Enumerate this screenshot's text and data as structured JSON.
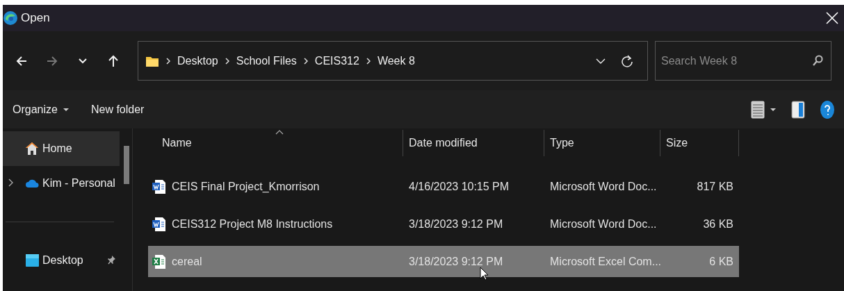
{
  "window": {
    "title": "Open"
  },
  "navigation": {
    "buttons": [
      {
        "kind": "back",
        "disabled": false
      },
      {
        "kind": "forward",
        "disabled": true
      },
      {
        "kind": "recent",
        "disabled": false
      },
      {
        "kind": "up",
        "disabled": false
      }
    ],
    "breadcrumb": [
      "Desktop",
      "School Files",
      "CEIS312",
      "Week 8"
    ],
    "search": {
      "placeholder": "Search Week 8"
    }
  },
  "toolbar": {
    "organize": "Organize",
    "new_folder": "New folder"
  },
  "sidebar": {
    "items": [
      {
        "label": "Home",
        "kind": "home",
        "selected": true,
        "expandable": false,
        "pinned": false
      },
      {
        "label": "Kim - Personal",
        "kind": "cloud",
        "selected": false,
        "expandable": true,
        "pinned": false
      },
      {
        "label": "Desktop",
        "kind": "desktop",
        "selected": false,
        "expandable": false,
        "pinned": true
      }
    ]
  },
  "table": {
    "columns": [
      "Name",
      "Date modified",
      "Type",
      "Size"
    ],
    "rows": [
      {
        "kind": "word",
        "name": "CEIS Final Project_Kmorrison",
        "date": "4/16/2023 10:15 PM",
        "type": "Microsoft Word Doc...",
        "size": "817 KB",
        "selected": false
      },
      {
        "kind": "word",
        "name": "CEIS312 Project M8 Instructions",
        "date": "3/18/2023 9:12 PM",
        "type": "Microsoft Word Doc...",
        "size": "36 KB",
        "selected": false
      },
      {
        "kind": "excel",
        "name": "cereal",
        "date": "3/18/2023 9:12 PM",
        "type": "Microsoft Excel Com...",
        "size": "6 KB",
        "selected": true
      }
    ]
  }
}
